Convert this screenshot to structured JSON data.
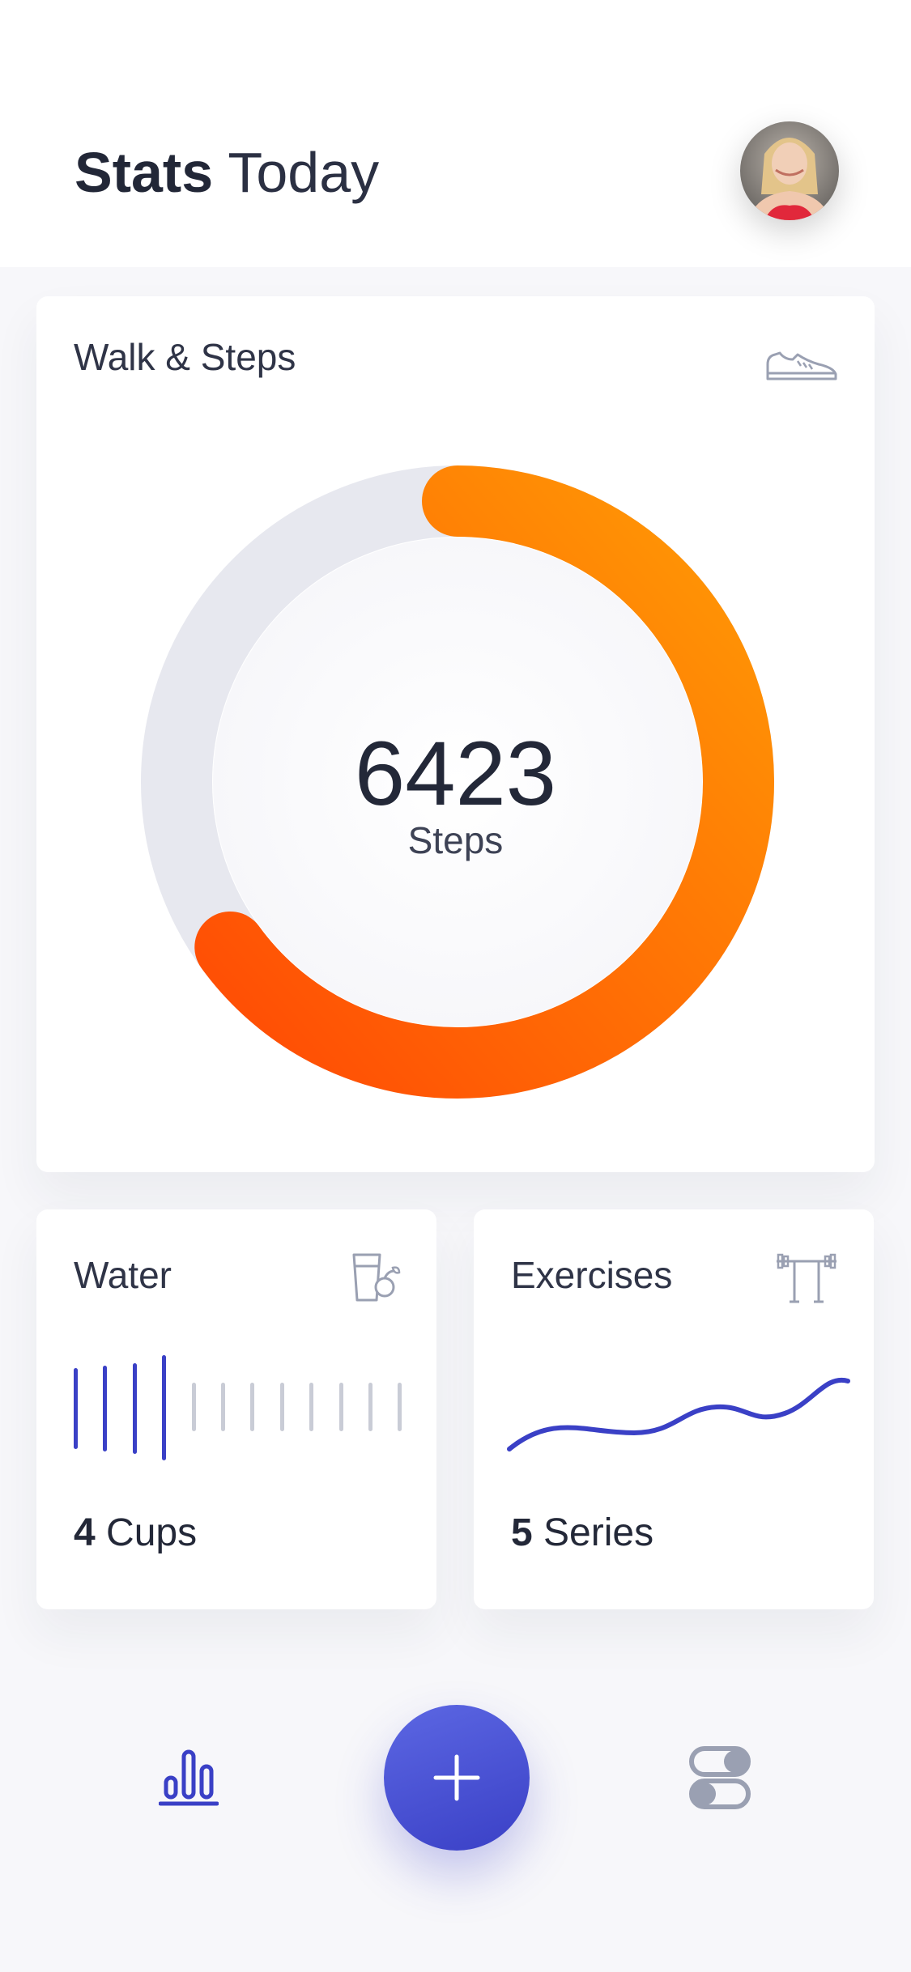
{
  "header": {
    "title_bold": "Stats",
    "title_light": "Today"
  },
  "walk": {
    "title": "Walk & Steps",
    "icon": "sneaker-icon",
    "steps_value": "6423",
    "steps_label": "Steps",
    "progress_fraction": 0.65
  },
  "water": {
    "title": "Water",
    "icon": "glass-with-fruit-icon",
    "cups_number": "4",
    "cups_unit": " Cups",
    "total_bars": 12,
    "filled_bars": 4
  },
  "exercises": {
    "title": "Exercises",
    "icon": "barbell-rack-icon",
    "series_number": "5",
    "series_unit": " Series"
  },
  "nav": {
    "stats_icon": "bar-chart-icon",
    "add_icon": "plus-icon",
    "settings_icon": "toggles-icon"
  },
  "colors": {
    "accent": "#3a40c6",
    "ring_start": "#ff4b05",
    "ring_end": "#ff9a05",
    "ring_track": "#e7e8ef",
    "inactive": "#c9ccd6"
  }
}
